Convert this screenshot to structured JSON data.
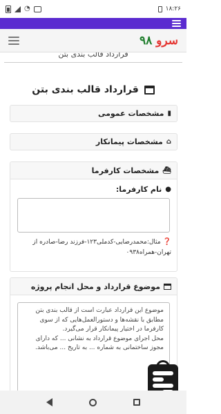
{
  "status_bar": {
    "time": "۱۸:۲۶",
    "left_icons": [
      "battery-icon",
      "signal-icon",
      "wifi-icon",
      "notification-icon"
    ],
    "right_icons": [
      "usb-icon"
    ]
  },
  "top_bar": {
    "menu_icon": "menu-icon"
  },
  "app_header": {
    "brand_part1": "سرو",
    "brand_part2": "۹۸",
    "brand_colors": {
      "part1": "#e53935",
      "part2": "#1e7d2c"
    },
    "menu_icon": "hamburger-icon"
  },
  "page": {
    "cut_off_title": "قرارداد قالب بندی بتن",
    "title": "قرارداد قالب بندی بتن",
    "title_icon": "window-icon"
  },
  "sections": [
    {
      "label": "مشخصات عمومی",
      "icon": "book-icon"
    },
    {
      "label": "مشخصات پیمانکار",
      "icon": "home-icon"
    }
  ],
  "employer_card": {
    "header": "مشخصات کارفرما",
    "header_icon": "ship-icon",
    "field_label": "نام کارفرما:",
    "field_icon": "user-icon",
    "field_value": "",
    "hint": "مثال:محمدرضایی-کدملی۱۲۳-فرزند رضا-صادره از تهران-همراه۰۹۳۸",
    "hint_icon": "question-circle-icon"
  },
  "subject_card": {
    "header": "موضوع قرارداد و محل انجام پروژه",
    "header_icon": "window-icon",
    "text_lines": [
      "موضوع این قرارداد عبارت است از قالب بندی بتن",
      "مطابق با نقشه‌ها و دستورالعمل‌هایی که از سوی",
      "کارفرما در اختیار پیمانکار قرار می‌گیرد.",
      "محل اجرای موضوع قرارداد به نشانی ... که دارای",
      "مجوز ساختمانی به شماره ... به تاریخ ... می‌باشد."
    ]
  },
  "nav_bar": {
    "back_icon": "back-icon",
    "home_icon": "home-circle-icon",
    "recents_icon": "recents-icon"
  }
}
